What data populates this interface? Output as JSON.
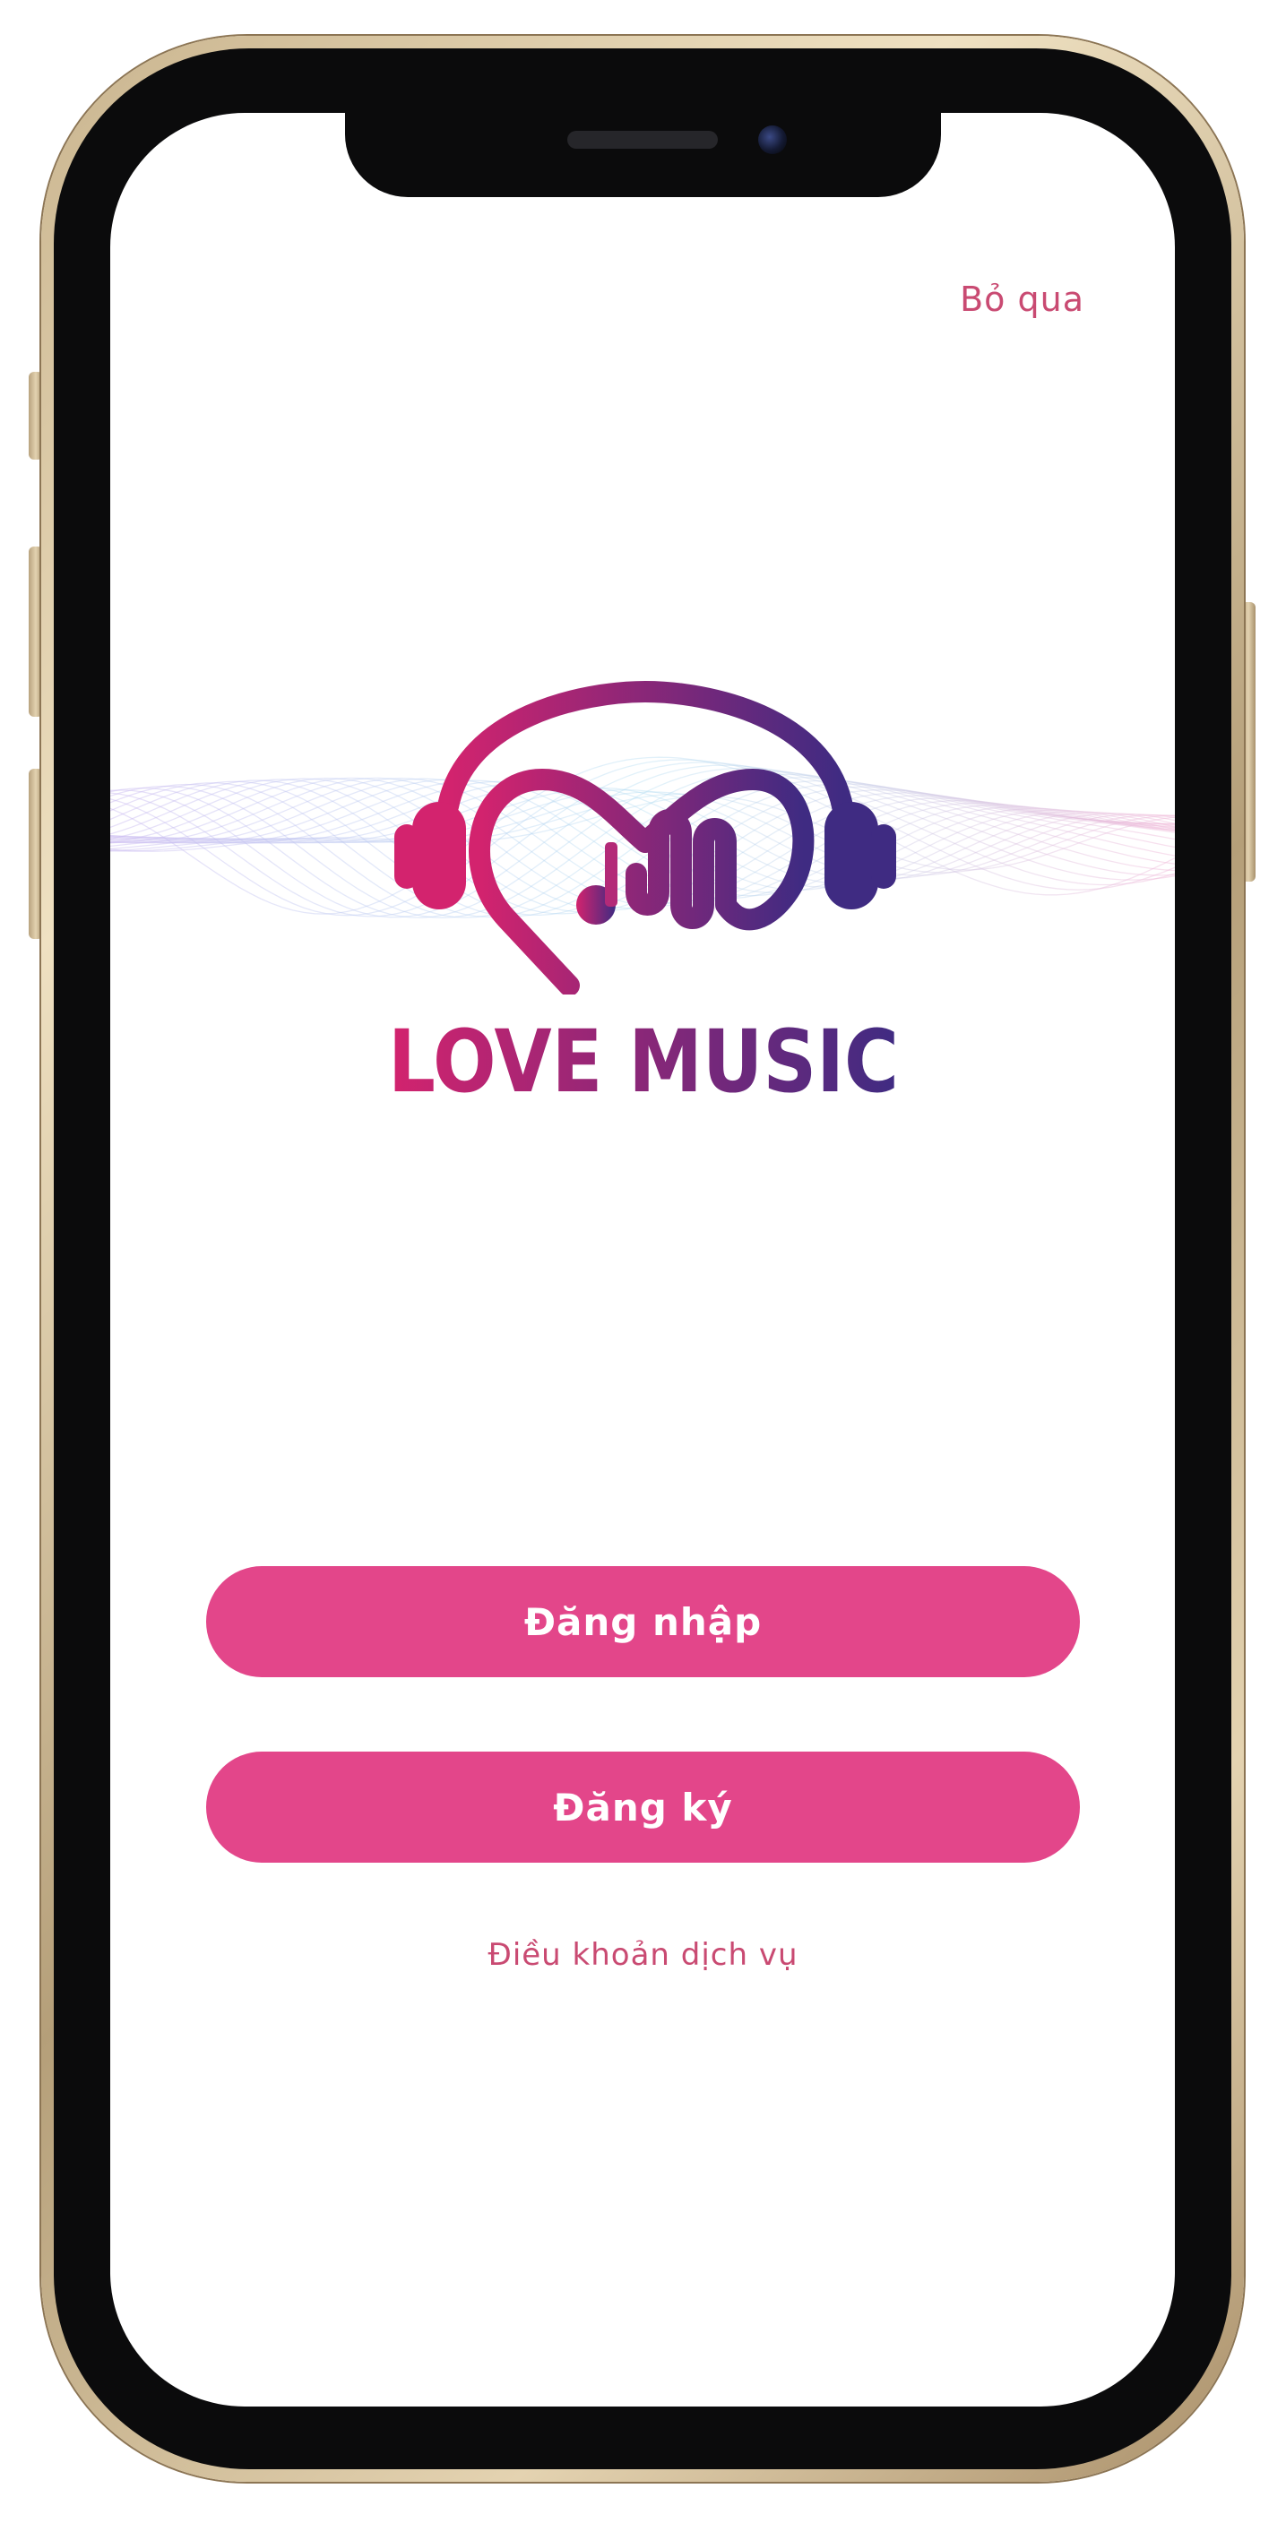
{
  "device": {
    "frame_color": "#d8c39d",
    "bezel_color": "#0b0b0c"
  },
  "header": {
    "skip_label": "Bỏ qua"
  },
  "brand": {
    "name": "LOVE MUSIC",
    "gradient_start": "#d3236e",
    "gradient_end": "#3f2b82",
    "logo_icon": "headphones-heart-icon"
  },
  "actions": {
    "login_label": "Đăng nhập",
    "signup_label": "Đăng ký",
    "button_color": "#e3468a"
  },
  "footer": {
    "terms_label": "Điều khoản dịch vụ",
    "link_color": "#c94a72"
  }
}
